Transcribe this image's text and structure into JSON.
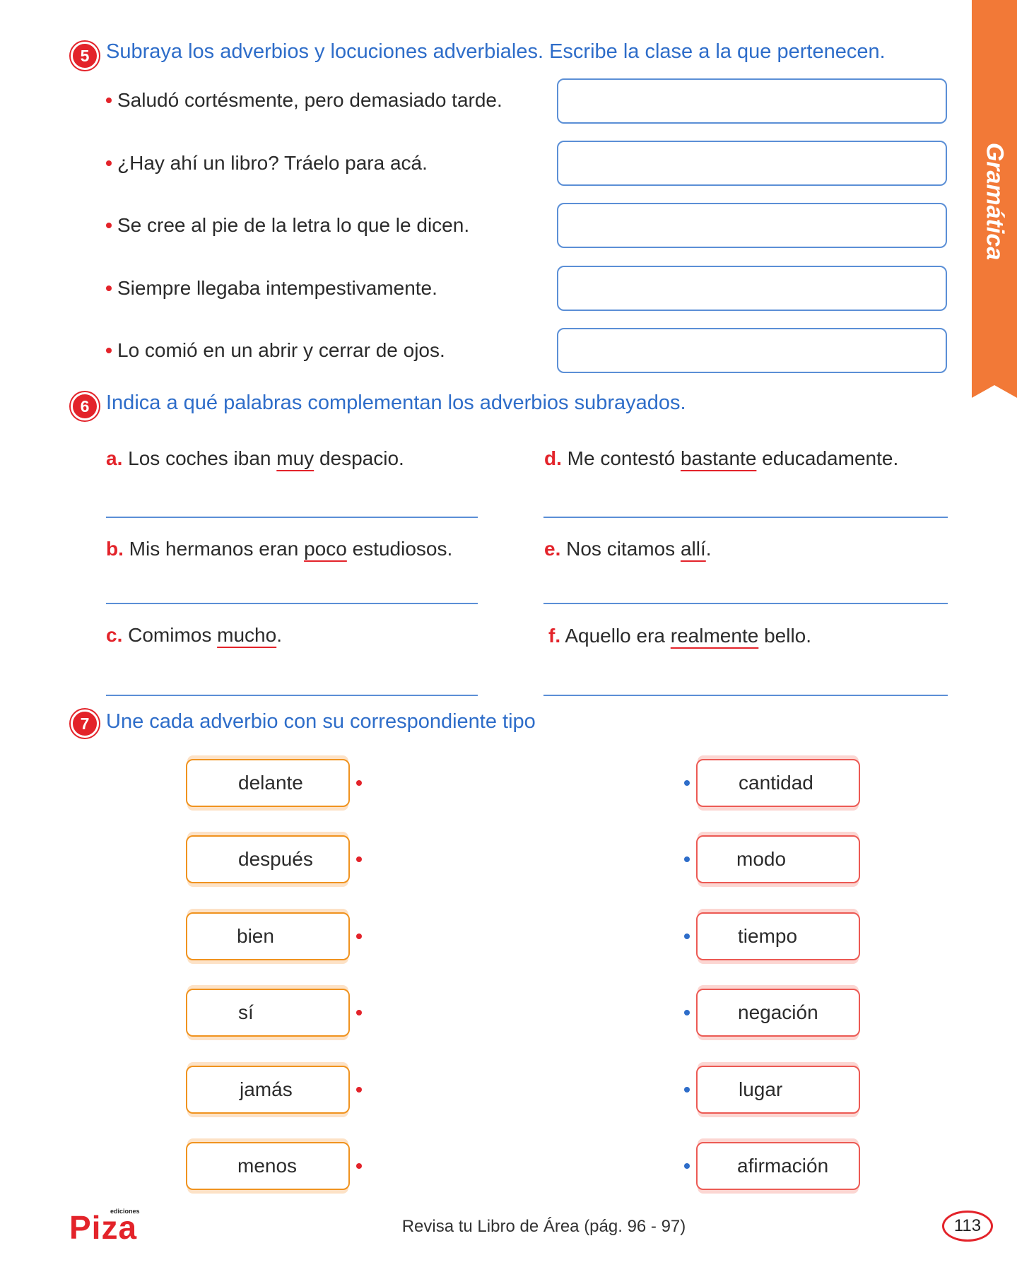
{
  "side_tab": {
    "label": "Gramática"
  },
  "ex5": {
    "number": "5",
    "instruction": "Subraya los adverbios y locuciones adverbiales. Escribe la clase a la que pertenecen.",
    "sentences": [
      "Saludó cortésmente, pero demasiado tarde.",
      "¿Hay ahí un libro? Tráelo para acá.",
      "Se cree al pie de la letra lo que le dicen.",
      "Siempre llegaba intempestivamente.",
      "Lo comió en un abrir y cerrar de ojos."
    ]
  },
  "ex6": {
    "number": "6",
    "instruction": "Indica a qué palabras complementan los adverbios subrayados.",
    "items": [
      {
        "letter": "a.",
        "before": "Los coches iban ",
        "adverb": "muy",
        "after": " despacio."
      },
      {
        "letter": "b.",
        "before": "Mis hermanos eran ",
        "adverb": "poco",
        "after": " estudiosos."
      },
      {
        "letter": "c.",
        "before": "Comimos ",
        "adverb": "mucho",
        "after": "."
      },
      {
        "letter": "d.",
        "before": "Me contestó ",
        "adverb": "bastante",
        "after": " educadamente."
      },
      {
        "letter": "e.",
        "before": "Nos citamos ",
        "adverb": "allí",
        "after": "."
      },
      {
        "letter": "f.",
        "before": "Aquello era ",
        "adverb": "realmente",
        "after": " bello."
      }
    ]
  },
  "ex7": {
    "number": "7",
    "instruction": "Une cada adverbio con su correspondiente tipo",
    "adverbs": [
      "delante",
      "después",
      "bien",
      "sí",
      "jamás",
      "menos"
    ],
    "types": [
      "cantidad",
      "modo",
      "tiempo",
      "negación",
      "lugar",
      "afirmación"
    ]
  },
  "footer": {
    "logo_small": "ediciones",
    "logo_main": "Piza",
    "reference": "Revisa tu Libro de Área (pág. 96 - 97)",
    "page_number": "113"
  },
  "colors": {
    "accent_red": "#e3232a",
    "instruction_blue": "#2e6dc9",
    "tab_orange": "#f27937"
  }
}
